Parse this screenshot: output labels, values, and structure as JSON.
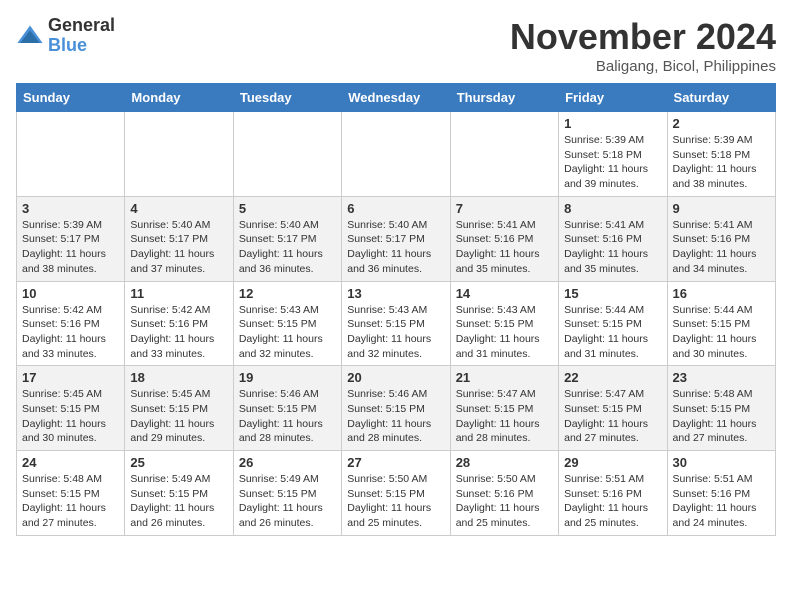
{
  "header": {
    "logo_general": "General",
    "logo_blue": "Blue",
    "month_year": "November 2024",
    "location": "Baligang, Bicol, Philippines"
  },
  "days_of_week": [
    "Sunday",
    "Monday",
    "Tuesday",
    "Wednesday",
    "Thursday",
    "Friday",
    "Saturday"
  ],
  "weeks": [
    [
      {
        "day": "",
        "empty": true
      },
      {
        "day": "",
        "empty": true
      },
      {
        "day": "",
        "empty": true
      },
      {
        "day": "",
        "empty": true
      },
      {
        "day": "",
        "empty": true
      },
      {
        "day": "1",
        "sunrise": "5:39 AM",
        "sunset": "5:18 PM",
        "daylight": "11 hours and 39 minutes."
      },
      {
        "day": "2",
        "sunrise": "5:39 AM",
        "sunset": "5:18 PM",
        "daylight": "11 hours and 38 minutes."
      }
    ],
    [
      {
        "day": "3",
        "sunrise": "5:39 AM",
        "sunset": "5:17 PM",
        "daylight": "11 hours and 38 minutes."
      },
      {
        "day": "4",
        "sunrise": "5:40 AM",
        "sunset": "5:17 PM",
        "daylight": "11 hours and 37 minutes."
      },
      {
        "day": "5",
        "sunrise": "5:40 AM",
        "sunset": "5:17 PM",
        "daylight": "11 hours and 36 minutes."
      },
      {
        "day": "6",
        "sunrise": "5:40 AM",
        "sunset": "5:17 PM",
        "daylight": "11 hours and 36 minutes."
      },
      {
        "day": "7",
        "sunrise": "5:41 AM",
        "sunset": "5:16 PM",
        "daylight": "11 hours and 35 minutes."
      },
      {
        "day": "8",
        "sunrise": "5:41 AM",
        "sunset": "5:16 PM",
        "daylight": "11 hours and 35 minutes."
      },
      {
        "day": "9",
        "sunrise": "5:41 AM",
        "sunset": "5:16 PM",
        "daylight": "11 hours and 34 minutes."
      }
    ],
    [
      {
        "day": "10",
        "sunrise": "5:42 AM",
        "sunset": "5:16 PM",
        "daylight": "11 hours and 33 minutes."
      },
      {
        "day": "11",
        "sunrise": "5:42 AM",
        "sunset": "5:16 PM",
        "daylight": "11 hours and 33 minutes."
      },
      {
        "day": "12",
        "sunrise": "5:43 AM",
        "sunset": "5:15 PM",
        "daylight": "11 hours and 32 minutes."
      },
      {
        "day": "13",
        "sunrise": "5:43 AM",
        "sunset": "5:15 PM",
        "daylight": "11 hours and 32 minutes."
      },
      {
        "day": "14",
        "sunrise": "5:43 AM",
        "sunset": "5:15 PM",
        "daylight": "11 hours and 31 minutes."
      },
      {
        "day": "15",
        "sunrise": "5:44 AM",
        "sunset": "5:15 PM",
        "daylight": "11 hours and 31 minutes."
      },
      {
        "day": "16",
        "sunrise": "5:44 AM",
        "sunset": "5:15 PM",
        "daylight": "11 hours and 30 minutes."
      }
    ],
    [
      {
        "day": "17",
        "sunrise": "5:45 AM",
        "sunset": "5:15 PM",
        "daylight": "11 hours and 30 minutes."
      },
      {
        "day": "18",
        "sunrise": "5:45 AM",
        "sunset": "5:15 PM",
        "daylight": "11 hours and 29 minutes."
      },
      {
        "day": "19",
        "sunrise": "5:46 AM",
        "sunset": "5:15 PM",
        "daylight": "11 hours and 28 minutes."
      },
      {
        "day": "20",
        "sunrise": "5:46 AM",
        "sunset": "5:15 PM",
        "daylight": "11 hours and 28 minutes."
      },
      {
        "day": "21",
        "sunrise": "5:47 AM",
        "sunset": "5:15 PM",
        "daylight": "11 hours and 28 minutes."
      },
      {
        "day": "22",
        "sunrise": "5:47 AM",
        "sunset": "5:15 PM",
        "daylight": "11 hours and 27 minutes."
      },
      {
        "day": "23",
        "sunrise": "5:48 AM",
        "sunset": "5:15 PM",
        "daylight": "11 hours and 27 minutes."
      }
    ],
    [
      {
        "day": "24",
        "sunrise": "5:48 AM",
        "sunset": "5:15 PM",
        "daylight": "11 hours and 27 minutes."
      },
      {
        "day": "25",
        "sunrise": "5:49 AM",
        "sunset": "5:15 PM",
        "daylight": "11 hours and 26 minutes."
      },
      {
        "day": "26",
        "sunrise": "5:49 AM",
        "sunset": "5:15 PM",
        "daylight": "11 hours and 26 minutes."
      },
      {
        "day": "27",
        "sunrise": "5:50 AM",
        "sunset": "5:15 PM",
        "daylight": "11 hours and 25 minutes."
      },
      {
        "day": "28",
        "sunrise": "5:50 AM",
        "sunset": "5:16 PM",
        "daylight": "11 hours and 25 minutes."
      },
      {
        "day": "29",
        "sunrise": "5:51 AM",
        "sunset": "5:16 PM",
        "daylight": "11 hours and 25 minutes."
      },
      {
        "day": "30",
        "sunrise": "5:51 AM",
        "sunset": "5:16 PM",
        "daylight": "11 hours and 24 minutes."
      }
    ]
  ],
  "labels": {
    "sunrise": "Sunrise:",
    "sunset": "Sunset:",
    "daylight": "Daylight:"
  }
}
